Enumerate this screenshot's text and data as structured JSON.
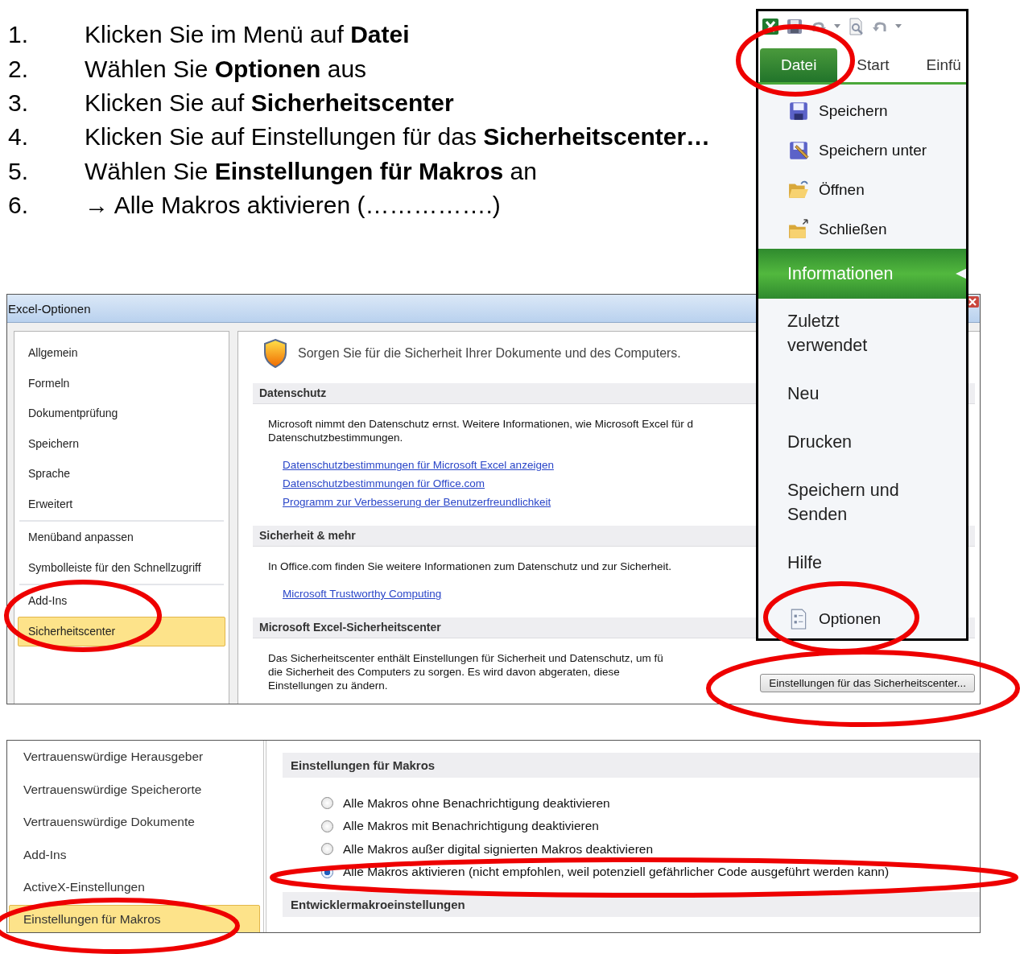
{
  "instructions": [
    {
      "number": "1.",
      "text": "Klicken Sie im Menü auf **Datei**"
    },
    {
      "number": "2.",
      "text": "Wählen Sie **Optionen** aus"
    },
    {
      "number": "3.",
      "text": "Klicken Sie auf **Sicherheitscenter**"
    },
    {
      "number": "4.",
      "text": "Klicken Sie auf Einstellungen für das **Sicherheitscenter…**"
    },
    {
      "number": "5.",
      "text": "Wählen Sie **Einstellungen für Makros** an"
    },
    {
      "number": "6.",
      "text": "→ Alle Makros aktivieren (…………….)"
    }
  ],
  "options_dialog": {
    "title": "Excel-Optionen",
    "sidebar": [
      [
        {
          "label": "Allgemein",
          "selected": false
        },
        {
          "label": "Formeln",
          "selected": false
        },
        {
          "label": "Dokumentprüfung",
          "selected": false
        },
        {
          "label": "Speichern",
          "selected": false
        },
        {
          "label": "Sprache",
          "selected": false
        },
        {
          "label": "Erweitert",
          "selected": false
        }
      ],
      [
        {
          "label": "Menüband anpassen",
          "selected": false
        },
        {
          "label": "Symbolleiste für den Schnellzugriff",
          "selected": false
        }
      ],
      [
        {
          "label": "Add-Ins",
          "selected": false
        },
        {
          "label": "Sicherheitscenter",
          "selected": true
        }
      ]
    ],
    "heading": "Sorgen Sie für die Sicherheit Ihrer Dokumente und des Computers.",
    "sections": [
      {
        "title": "Datenschutz",
        "paragraph": [
          "Microsoft nimmt den Datenschutz ernst. Weitere Informationen, wie Microsoft Excel für d",
          "Datenschutzbestimmungen."
        ],
        "links": [
          "Datenschutzbestimmungen für Microsoft Excel anzeigen",
          "Datenschutzbestimmungen für Office.com",
          "Programm zur Verbesserung der Benutzerfreundlichkeit"
        ]
      },
      {
        "title": "Sicherheit & mehr",
        "paragraph": [
          "In Office.com finden Sie weitere Informationen zum Datenschutz und zur Sicherheit."
        ],
        "links": [
          "Microsoft Trustworthy Computing"
        ]
      },
      {
        "title": "Microsoft Excel-Sicherheitscenter",
        "paragraph": [
          "Das Sicherheitscenter enthält Einstellungen für Sicherheit und Datenschutz, um fü",
          "die Sicherheit des Computers zu sorgen. Es wird davon abgeraten, diese",
          "Einstellungen zu ändern."
        ],
        "button": "Einstellungen für das Sicherheitscenter..."
      }
    ]
  },
  "file_menu": {
    "tabs": [
      {
        "label": "Datei",
        "selected": true
      },
      {
        "label": "Start",
        "selected": false
      },
      {
        "label": "Einfü",
        "selected": false
      }
    ],
    "items": [
      {
        "kind": "command",
        "label": "Speichern",
        "selected": false
      },
      {
        "kind": "command",
        "label": "Speichern unter",
        "selected": false
      },
      {
        "kind": "command",
        "label": "Öffnen",
        "selected": false
      },
      {
        "kind": "command",
        "label": "Schließen",
        "selected": false
      },
      {
        "kind": "page",
        "label": "Informationen",
        "selected": true
      },
      {
        "kind": "page",
        "label": "Zuletzt verwendet",
        "selected": false
      },
      {
        "kind": "page",
        "label": "Neu",
        "selected": false
      },
      {
        "kind": "page",
        "label": "Drucken",
        "selected": false
      },
      {
        "kind": "page",
        "label": "Speichern und Senden",
        "selected": false
      },
      {
        "kind": "page",
        "label": "Hilfe",
        "selected": false
      },
      {
        "kind": "command",
        "label": "Optionen",
        "selected": false
      }
    ]
  },
  "trust_center": {
    "sidebar": [
      {
        "label": "Vertrauenswürdige Herausgeber",
        "selected": false
      },
      {
        "label": "Vertrauenswürdige Speicherorte",
        "selected": false
      },
      {
        "label": "Vertrauenswürdige Dokumente",
        "selected": false
      },
      {
        "label": "Add-Ins",
        "selected": false
      },
      {
        "label": "ActiveX-Einstellungen",
        "selected": false
      },
      {
        "label": "Einstellungen für Makros",
        "selected": true
      }
    ],
    "sections": [
      {
        "title": "Einstellungen für Makros",
        "options": [
          {
            "label": "Alle Makros ohne Benachrichtigung deaktivieren",
            "selected": false
          },
          {
            "label": "Alle Makros mit Benachrichtigung deaktivieren",
            "selected": false
          },
          {
            "label": "Alle Makros außer digital signierten Makros deaktivieren",
            "selected": false
          },
          {
            "label": "Alle Makros aktivieren (nicht empfohlen, weil potenziell gefährlicher Code ausgeführt werden kann)",
            "selected": true
          }
        ]
      },
      {
        "title": "Entwicklermakroeinstellungen"
      }
    ]
  }
}
